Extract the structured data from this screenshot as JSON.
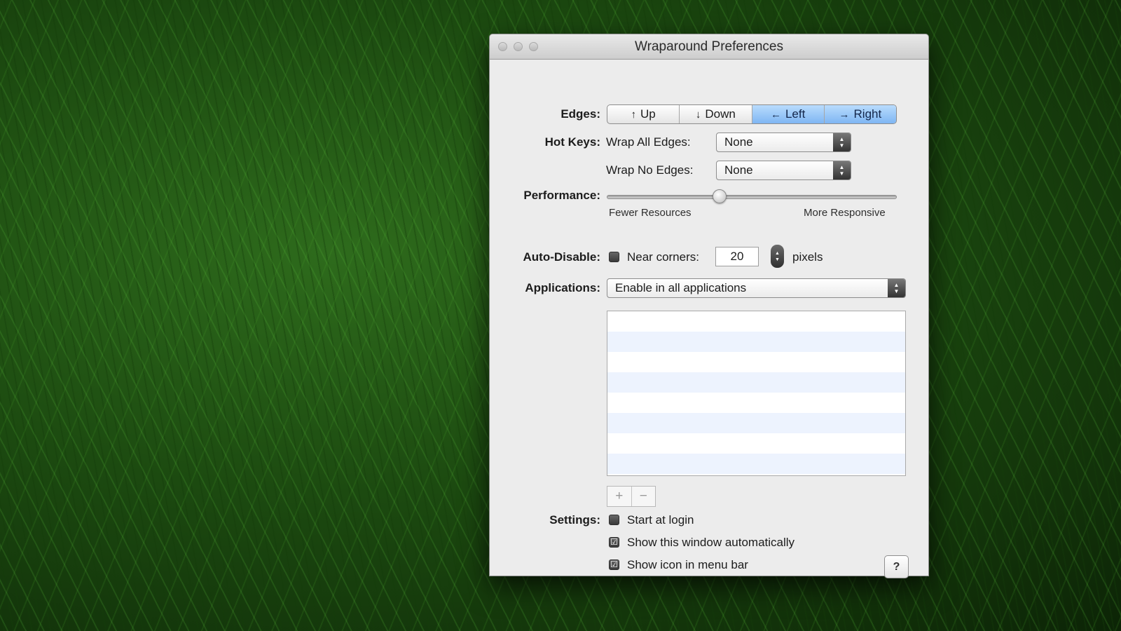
{
  "window": {
    "title": "Wraparound Preferences"
  },
  "edges": {
    "label": "Edges:",
    "segments": [
      {
        "glyph": "↑",
        "label": "Up",
        "selected": false
      },
      {
        "glyph": "↓",
        "label": "Down",
        "selected": false
      },
      {
        "glyph": "←",
        "label": "Left",
        "selected": true
      },
      {
        "glyph": "→",
        "label": "Right",
        "selected": true
      }
    ]
  },
  "hotkeys": {
    "label": "Hot Keys:",
    "wrap_all_label": "Wrap All Edges:",
    "wrap_all_value": "None",
    "wrap_none_label": "Wrap No Edges:",
    "wrap_none_value": "None"
  },
  "performance": {
    "label": "Performance:",
    "min_label": "Fewer Resources",
    "max_label": "More Responsive",
    "value_fraction": 0.39
  },
  "auto_disable": {
    "label": "Auto-Disable:",
    "checkbox_label": "Near corners:",
    "checked": false,
    "value": "20",
    "unit": "pixels"
  },
  "applications": {
    "label": "Applications:",
    "selected": "Enable in all applications",
    "add_label": "+",
    "remove_label": "−"
  },
  "settings": {
    "label": "Settings:",
    "items": [
      {
        "label": "Start at login",
        "checked": false
      },
      {
        "label": "Show this window automatically",
        "checked": true
      },
      {
        "label": "Show icon in menu bar",
        "checked": true
      }
    ]
  },
  "help": {
    "label": "?"
  },
  "icons": {
    "checkmark": "☑",
    "popup_arrows": "▲▼"
  },
  "colors": {
    "selected_segment": "#7fb6f3",
    "window_bg": "#ececec"
  }
}
